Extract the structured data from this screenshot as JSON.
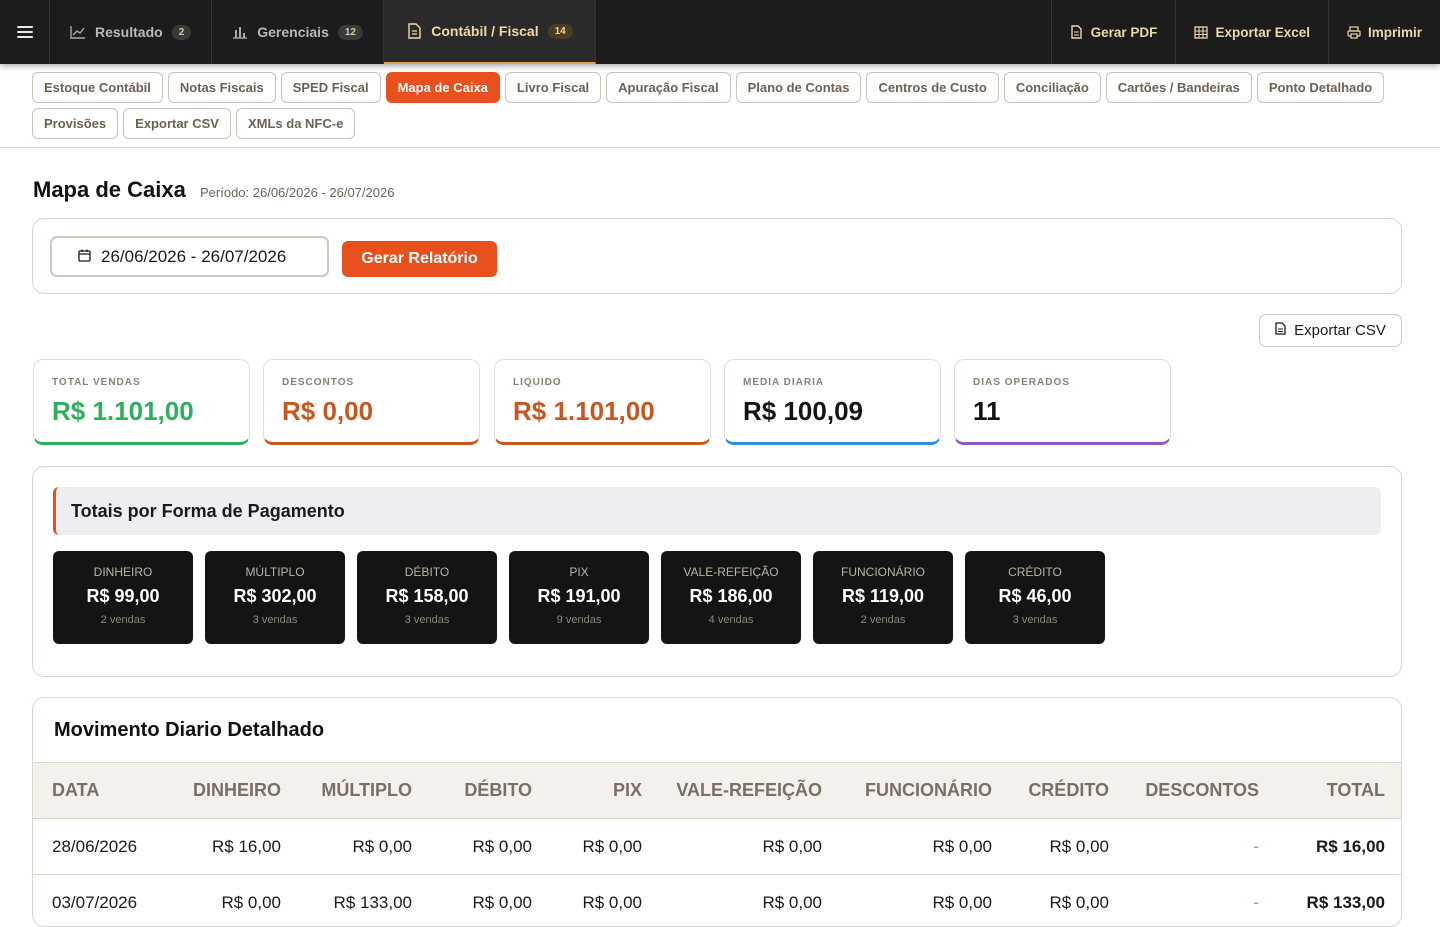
{
  "nav": {
    "tabs": [
      {
        "label": "Resultado",
        "count": "2",
        "icon": "line-chart-icon"
      },
      {
        "label": "Gerenciais",
        "count": "12",
        "icon": "bar-chart-icon"
      },
      {
        "label": "Contábil / Fiscal",
        "count": "14",
        "icon": "document-icon"
      }
    ],
    "actions": [
      {
        "label": "Gerar PDF",
        "icon": "pdf-file-icon"
      },
      {
        "label": "Exportar Excel",
        "icon": "table-grid-icon"
      },
      {
        "label": "Imprimir",
        "icon": "printer-icon"
      }
    ],
    "accent": "#d9a441"
  },
  "subtabs": [
    "Estoque Contábil",
    "Notas Fiscais",
    "SPED Fiscal",
    "Mapa de Caixa",
    "Livro Fiscal",
    "Apuração Fiscal",
    "Plano de Contas",
    "Centros de Custo",
    "Conciliação",
    "Cartões / Bandeiras",
    "Ponto Detalhado",
    "Provisões",
    "Exportar CSV",
    "XMLs da NFC-e"
  ],
  "page": {
    "title": "Mapa de Caixa",
    "period": "Período: 26/06/2026 - 26/07/2026"
  },
  "filter": {
    "date_range": "26/06/2026 - 26/07/2026",
    "generate_label": "Gerar Relatório",
    "primary_color": "#e8501e"
  },
  "export_csv_label": "Exportar CSV",
  "kpis": [
    {
      "label": "TOTAL VENDAS",
      "value": "R$ 1.101,00",
      "color": "#2eaf5c"
    },
    {
      "label": "DESCONTOS",
      "value": "R$ 0,00",
      "color": "#c9561e"
    },
    {
      "label": "LIQUIDO",
      "value": "R$ 1.101,00",
      "color": "#c9561e"
    },
    {
      "label": "MEDIA DIARIA",
      "value": "R$ 100,09",
      "color": "#2f8fd8"
    },
    {
      "label": "DIAS OPERADOS",
      "value": "11",
      "color": "#8e58c8"
    }
  ],
  "payments": {
    "title": "Totais por Forma de Pagamento",
    "items": [
      {
        "label": "DINHEIRO",
        "value": "R$ 99,00",
        "count": "2 vendas"
      },
      {
        "label": "MÚLTIPLO",
        "value": "R$ 302,00",
        "count": "3 vendas"
      },
      {
        "label": "DÉBITO",
        "value": "R$ 158,00",
        "count": "3 vendas"
      },
      {
        "label": "PIX",
        "value": "R$ 191,00",
        "count": "9 vendas"
      },
      {
        "label": "VALE-REFEIÇÃO",
        "value": "R$ 186,00",
        "count": "4 vendas"
      },
      {
        "label": "FUNCIONÁRIO",
        "value": "R$ 119,00",
        "count": "2 vendas"
      },
      {
        "label": "CRÉDITO",
        "value": "R$ 46,00",
        "count": "3 vendas"
      }
    ]
  },
  "daily": {
    "title": "Movimento Diario Detalhado",
    "headers": [
      "DATA",
      "DINHEIRO",
      "MÚLTIPLO",
      "DÉBITO",
      "PIX",
      "VALE-REFEIÇÃO",
      "FUNCIONÁRIO",
      "CRÉDITO",
      "DESCONTOS",
      "TOTAL"
    ],
    "rows": [
      [
        "28/06/2026",
        "R$ 16,00",
        "R$ 0,00",
        "R$ 0,00",
        "R$ 0,00",
        "R$ 0,00",
        "R$ 0,00",
        "R$ 0,00",
        "-",
        "R$ 16,00"
      ],
      [
        "03/07/2026",
        "R$ 0,00",
        "R$ 133,00",
        "R$ 0,00",
        "R$ 0,00",
        "R$ 0,00",
        "R$ 0,00",
        "R$ 0,00",
        "-",
        "R$ 133,00"
      ]
    ]
  }
}
